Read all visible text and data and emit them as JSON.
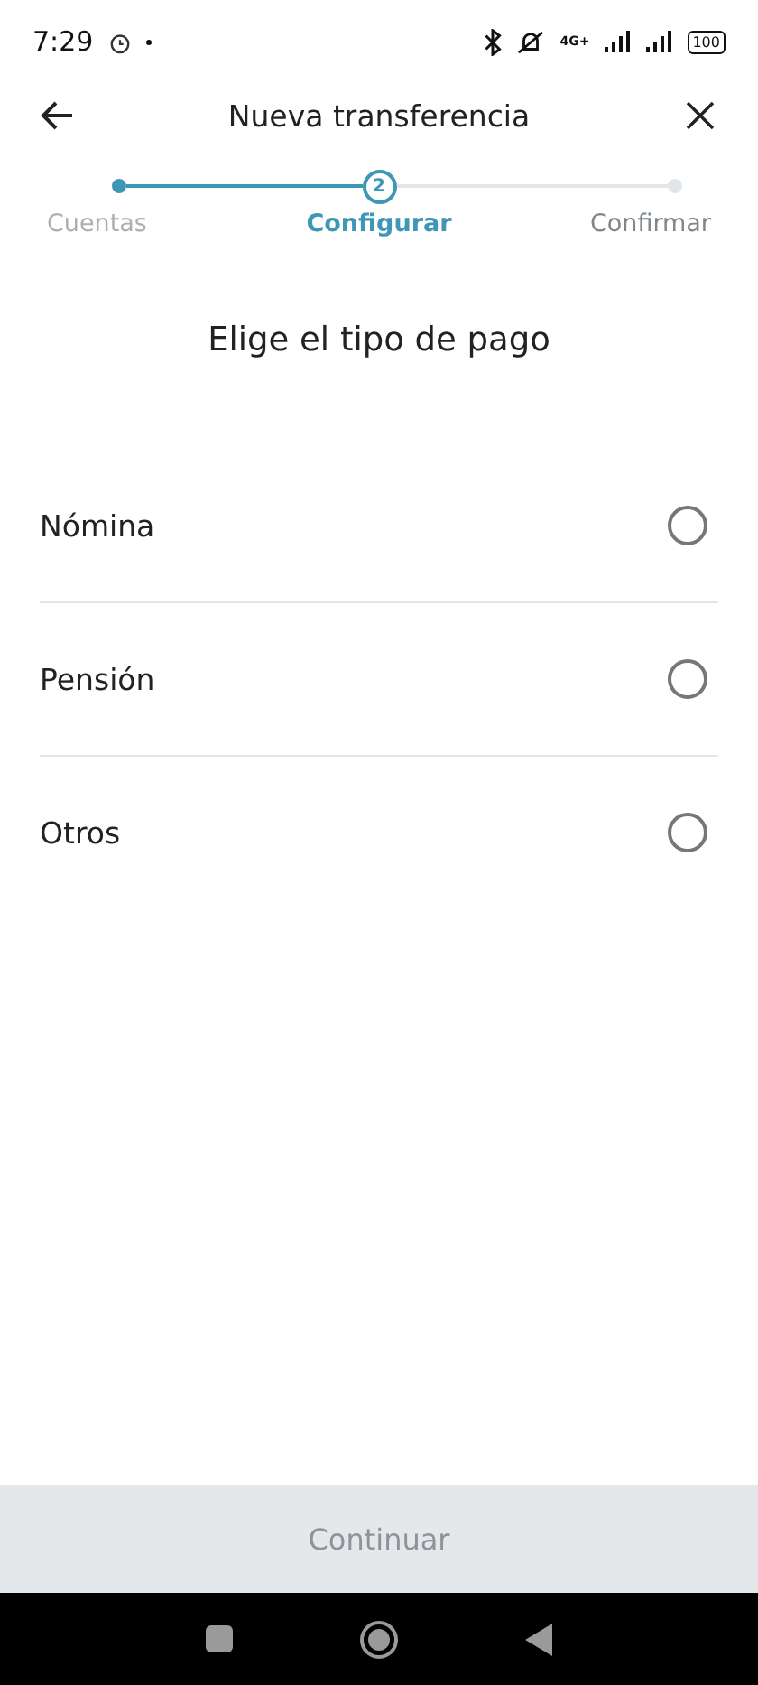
{
  "status_bar": {
    "time": "7:29",
    "network": "4G+",
    "battery": "100"
  },
  "header": {
    "title": "Nueva transferencia"
  },
  "steps": [
    {
      "label": "Cuentas",
      "kind": "done"
    },
    {
      "label": "Configurar",
      "kind": "current",
      "number": "2"
    },
    {
      "label": "Confirmar",
      "kind": "todo"
    }
  ],
  "heading": "Elige el tipo de pago",
  "options": [
    {
      "label": "Nómina",
      "selected": false
    },
    {
      "label": "Pensión",
      "selected": false
    },
    {
      "label": "Otros",
      "selected": false
    }
  ],
  "continue_button": {
    "label": "Continuar",
    "disabled": true
  }
}
